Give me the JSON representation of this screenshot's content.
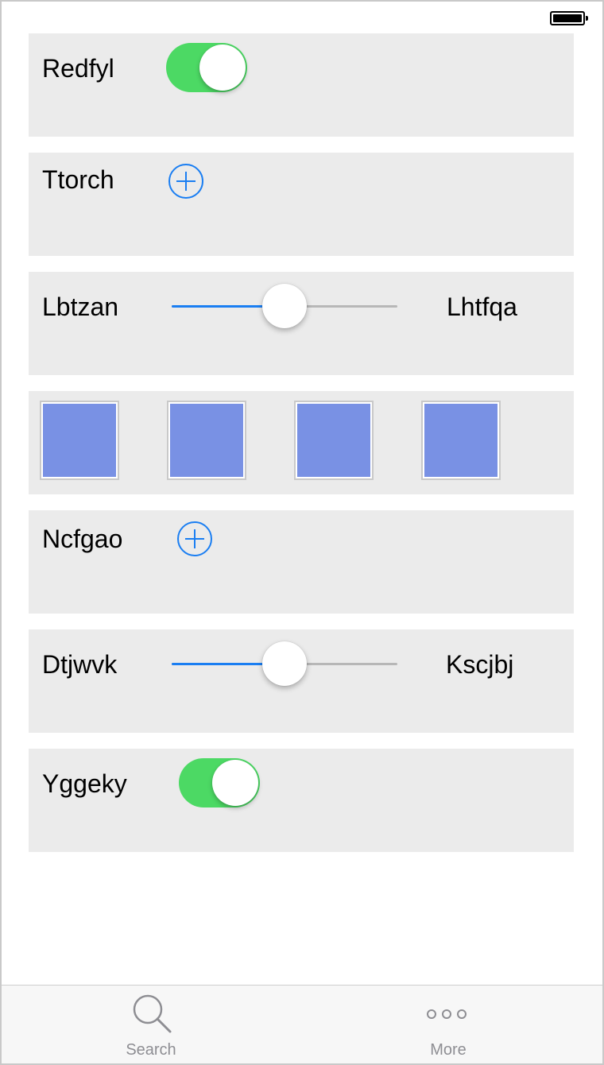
{
  "rows": {
    "redfyl": {
      "label": "Redfyl",
      "toggle_on": true
    },
    "ttorch": {
      "label": "Ttorch"
    },
    "lbtzan": {
      "left_label": "Lbtzan",
      "right_label": "Lhtfqa",
      "value": 0.5
    },
    "swatches": {
      "count": 4,
      "color": "#7991e4"
    },
    "ncfgao": {
      "label": "Ncfgao"
    },
    "dtjwvk": {
      "left_label": "Dtjwvk",
      "right_label": "Kscjbj",
      "value": 0.5
    },
    "yggeky": {
      "label": "Yggeky",
      "toggle_on": true
    }
  },
  "tabbar": {
    "search": {
      "label": "Search",
      "icon": "search-icon"
    },
    "more": {
      "label": "More",
      "icon": "more-icon"
    }
  },
  "colors": {
    "toggle_on": "#4cd964",
    "accent": "#1a7ef2",
    "card_bg": "#ebebeb",
    "tab_inactive": "#8e8e93"
  }
}
